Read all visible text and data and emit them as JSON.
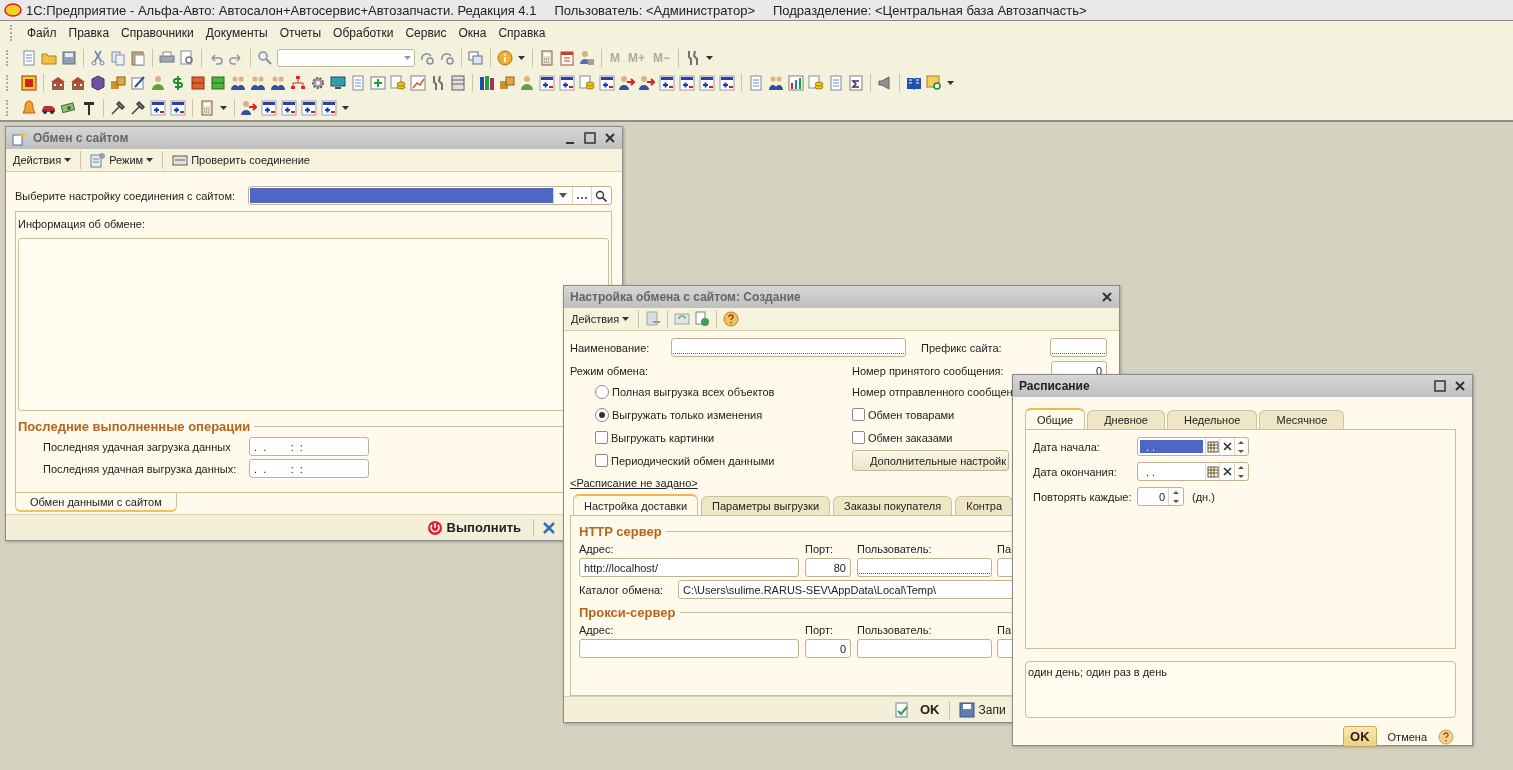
{
  "app": {
    "title": "1С:Предприятие - Альфа-Авто: Автосалон+Автосервис+Автозапчасти. Редакция 4.1",
    "user": "Пользователь: <Администратор>",
    "division": "Подразделение: <Центральная база Автозапчасть>"
  },
  "menu": [
    {
      "label": "Файл"
    },
    {
      "label": "Правка"
    },
    {
      "label": "Справочники"
    },
    {
      "label": "Документы"
    },
    {
      "label": "Отчеты"
    },
    {
      "label": "Обработки"
    },
    {
      "label": "Сервис"
    },
    {
      "label": "Окна"
    },
    {
      "label": "Справка"
    }
  ],
  "memory_buttons": [
    {
      "label": "M",
      "disabled": true
    },
    {
      "label": "M+",
      "disabled": true
    },
    {
      "label": "M−",
      "disabled": true
    }
  ],
  "exchange_window": {
    "title": "Обмен с сайтом",
    "actions": "Действия",
    "mode": "Режим",
    "check": "Проверить соединение",
    "connection_label": "Выберите настройку соединения с сайтом:",
    "connection_focused": true,
    "info_label": "Информация об обмене:",
    "section": "Последние выполненные операции",
    "last_ops": [
      {
        "label": "Последняя удачная загрузка данных",
        "value": ".  .        :  :"
      },
      {
        "label": "Последняя удачная выгрузка данных:",
        "value": ".  .        :  :"
      }
    ],
    "tabs": [
      {
        "label": "Обмен данными с сайтом",
        "selected": true
      }
    ],
    "run": "Выполнить"
  },
  "settings_window": {
    "title": "Настройка обмена с сайтом: Создание",
    "actions": "Действия",
    "name_label": "Наименование:",
    "name_required": true,
    "prefix_label": "Префикс сайта:",
    "prefix_required": true,
    "mode_label": "Режим обмена:",
    "options": [
      {
        "kind": "radio",
        "label": "Полная выгрузка всех объектов",
        "selected": false
      },
      {
        "kind": "radio",
        "label": "Выгружать только изменения",
        "selected": true
      },
      {
        "kind": "checkbox",
        "label": "Выгружать картинки",
        "checked": false
      },
      {
        "kind": "checkbox",
        "label": "Периодический обмен данными",
        "checked": false
      }
    ],
    "received_label": "Номер принятого сообщения:",
    "received_value": "0",
    "sent_label": "Номер отправленного сообщен",
    "exchange_checks": [
      {
        "label": "Обмен товарами",
        "checked": false
      },
      {
        "label": "Обмен заказами",
        "checked": false
      }
    ],
    "extra_button": "Дополнительные настройк",
    "schedule_link": "<Расписание не задано>",
    "tabs": [
      {
        "label": "Настройка доставки",
        "selected": true
      },
      {
        "label": "Параметры выгрузки",
        "selected": false
      },
      {
        "label": "Заказы покупателя",
        "selected": false
      },
      {
        "label": "Контра",
        "selected": false
      }
    ],
    "http": {
      "title": "HTTP сервер",
      "address_label": "Адрес:",
      "port_label": "Порт:",
      "user_label": "Пользователь:",
      "password_label": "Па",
      "address": "http://localhost/",
      "port": "80",
      "user_required": true
    },
    "catalog_label": "Каталог обмена:",
    "catalog": "C:\\Users\\sulime.RARUS-SEV\\AppData\\Local\\Temp\\",
    "proxy": {
      "title": "Прокси-сервер",
      "address_label": "Адрес:",
      "port_label": "Порт:",
      "user_label": "Пользователь:",
      "password_label": "Па",
      "port": "0",
      "user_required": false
    },
    "ok": "OK",
    "save": "Запи"
  },
  "schedule_window": {
    "title": "Расписание",
    "tabs": [
      {
        "label": "Общие",
        "selected": true
      },
      {
        "label": "Дневное",
        "selected": false
      },
      {
        "label": "Недельное",
        "selected": false
      },
      {
        "label": "Месячное",
        "selected": false
      }
    ],
    "start_label": "Дата начала:",
    "start_value": ". .",
    "start_focused": true,
    "end_label": "Дата окончания:",
    "end_value": ". .",
    "repeat_label": "Повторять каждые:",
    "repeat_value": "0",
    "repeat_unit": "(дн.)",
    "summary": "один день; один раз в день",
    "ok": "OK",
    "cancel": "Отмена"
  }
}
